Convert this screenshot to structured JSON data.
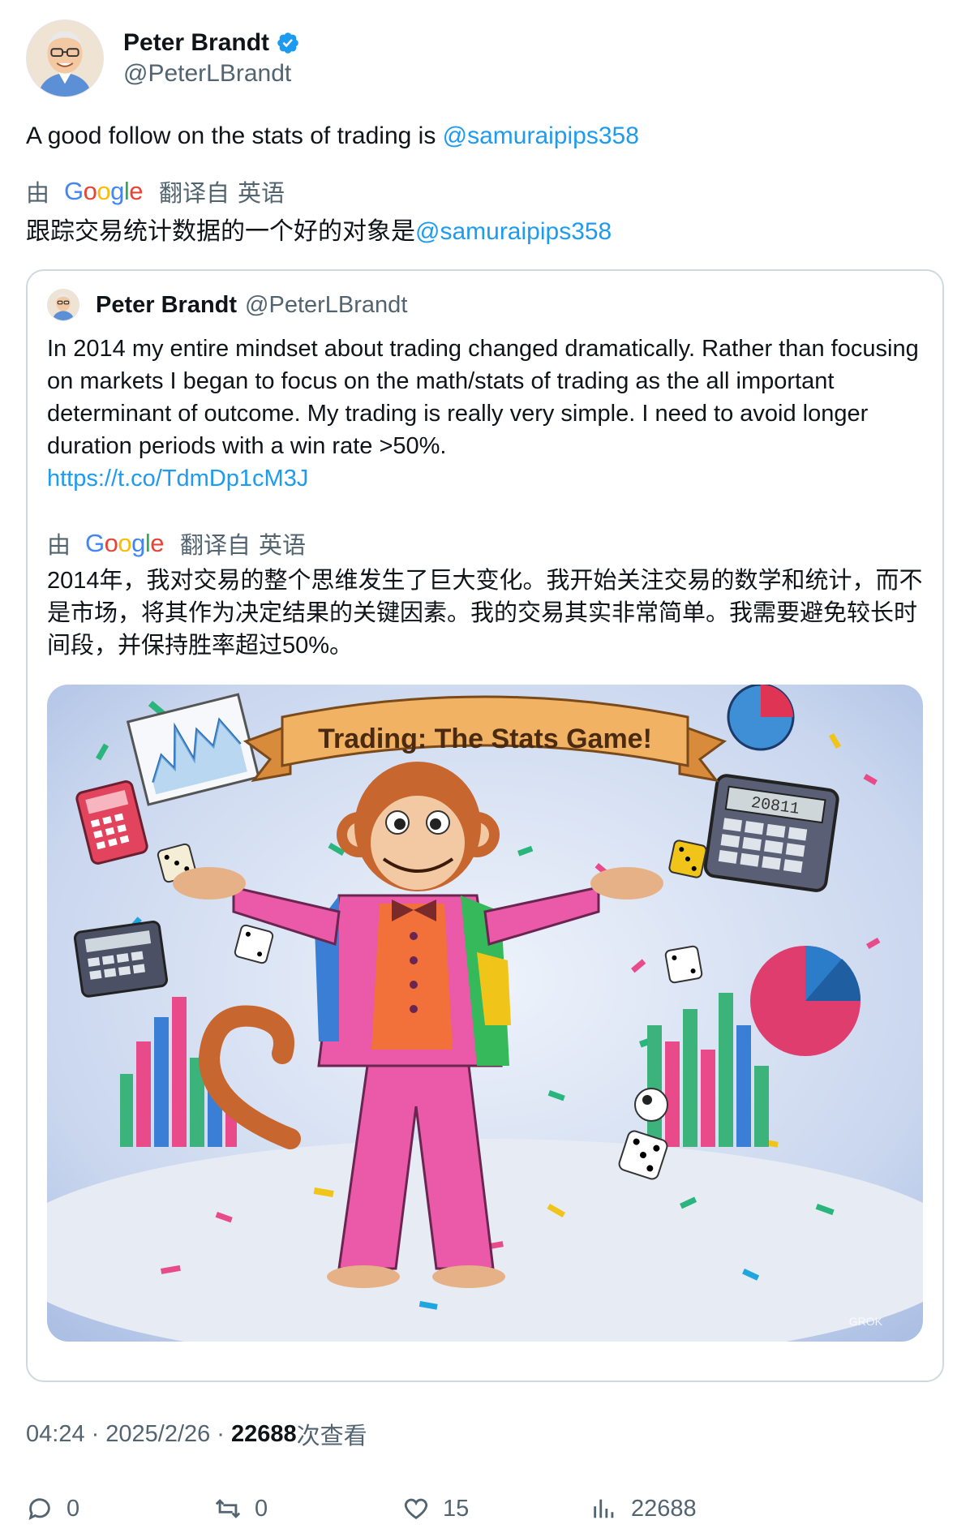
{
  "author": {
    "name": "Peter Brandt",
    "handle": "@PeterLBrandt",
    "verified": true,
    "avatar_icon": "cartoon-portrait"
  },
  "tweet": {
    "text_before": "A good follow on the stats of trading is ",
    "mention": "@samuraipips358"
  },
  "translation": {
    "by_label": "由",
    "provider": "Google",
    "translated_from": "翻译自",
    "language": "英语",
    "text_before": "跟踪交易统计数据的一个好的对象是",
    "mention": "@samuraipips358"
  },
  "quote": {
    "name": "Peter Brandt",
    "handle": "@PeterLBrandt",
    "text": "In 2014 my entire mindset about trading changed dramatically. Rather than focusing on markets I began to focus on the math/stats of trading as the all important determinant of outcome. My trading is really very simple. I need to avoid longer duration periods with a win rate >50%.",
    "link": "https://t.co/TdmDp1cM3J",
    "translation": {
      "by_label": "由",
      "provider": "Google",
      "translated_from": "翻译自",
      "language": "英语",
      "text": "2014年，我对交易的整个思维发生了巨大变化。我开始关注交易的数学和统计，而不是市场，将其作为决定结果的关键因素。我的交易其实非常简单。我需要避免较长时间段，并保持胜率超过50%。"
    },
    "image": {
      "banner_text": "Trading: The Stats Game!",
      "watermark": "GROK",
      "calculator_display": "20811"
    }
  },
  "meta": {
    "time": "04:24",
    "separator": "·",
    "date": "2025/2/26",
    "views": "22688",
    "views_label": "次查看"
  },
  "actions": {
    "replies": "0",
    "reposts": "0",
    "likes": "15",
    "views": "22688"
  },
  "colors": {
    "link": "#1d9bf0",
    "secondary_text": "#536471",
    "border": "#cfd9de",
    "verified": "#1d9bf0"
  }
}
